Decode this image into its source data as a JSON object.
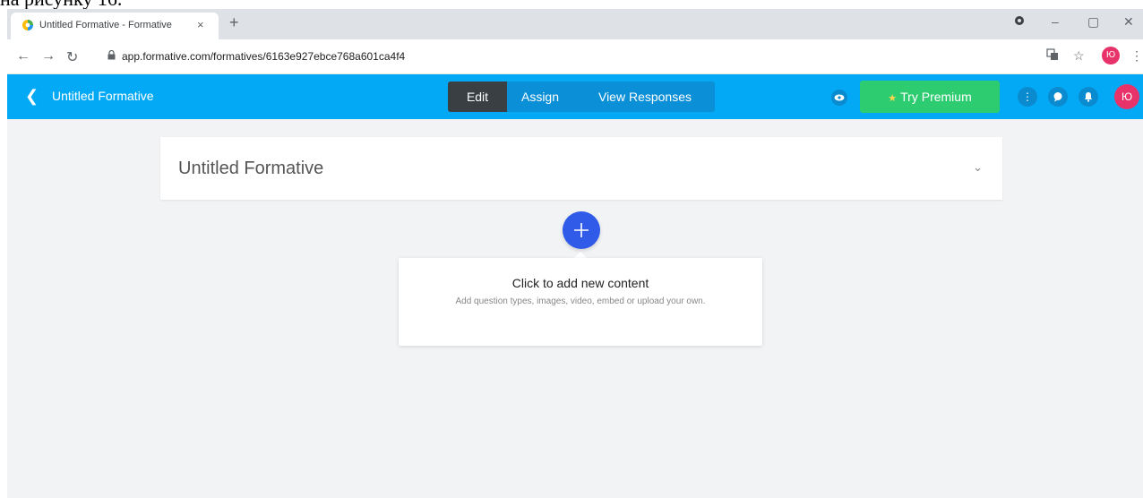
{
  "page_caption": "на рисунку 16.",
  "browser": {
    "tab_title": "Untitled Formative - Formative",
    "tab_close": "×",
    "new_tab": "+",
    "url": "app.formative.com/formatives/6163e927ebce768a601ca4f4",
    "profile_initial": "Ю",
    "window_controls": {
      "minimize": "–",
      "maximize": "▢",
      "close": "✕"
    }
  },
  "appbar": {
    "back_label": "Untitled Formative",
    "tabs": [
      {
        "label": "Edit",
        "active": true
      },
      {
        "label": "Assign",
        "active": false
      },
      {
        "label": "View Responses",
        "active": false
      }
    ],
    "premium_label": "Try Premium",
    "user_initial": "Ю"
  },
  "editor": {
    "title": "Untitled Formative",
    "add_content_title": "Click to add new content",
    "add_content_desc": "Add question types, images, video, embed or upload your own."
  },
  "colors": {
    "appbar": "#03a9f4",
    "active_tab": "#3a3f44",
    "premium": "#2ecc71",
    "add_button": "#2f5be8",
    "avatar": "#e8336a",
    "workspace": "#f2f3f5"
  }
}
